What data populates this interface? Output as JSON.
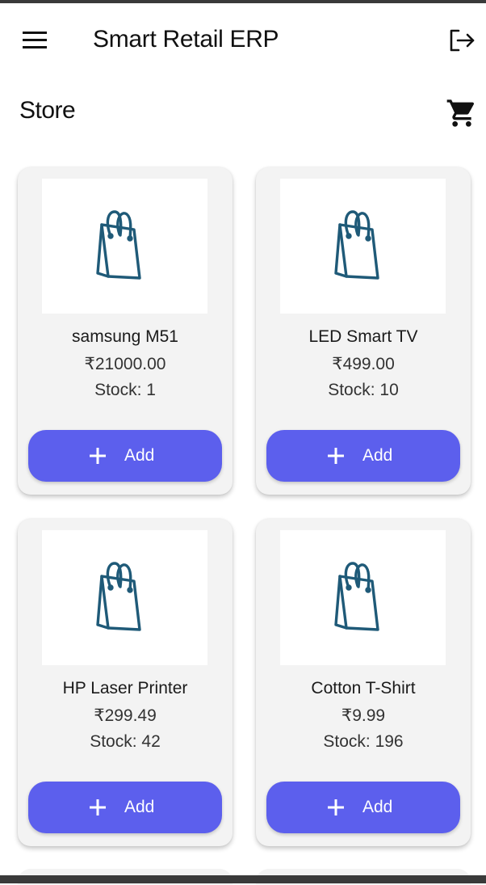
{
  "app_bar": {
    "title": "Smart Retail ERP",
    "menu_icon": "hamburger-menu-icon",
    "logout_icon": "logout-icon"
  },
  "store": {
    "title": "Store",
    "cart_icon": "shopping-cart-icon"
  },
  "theme": {
    "accent": "#5C5FED",
    "icon_color": "#1F5A78",
    "card_bg": "#F3F3F3"
  },
  "products": [
    {
      "name": "samsung M51",
      "price": "₹21000.00",
      "stock": "Stock: 1",
      "add_label": "Add",
      "image_icon": "shopping-bag-icon"
    },
    {
      "name": "LED Smart TV",
      "price": "₹499.00",
      "stock": "Stock: 10",
      "add_label": "Add",
      "image_icon": "shopping-bag-icon"
    },
    {
      "name": "HP Laser Printer",
      "price": "₹299.49",
      "stock": "Stock: 42",
      "add_label": "Add",
      "image_icon": "shopping-bag-icon"
    },
    {
      "name": "Cotton T-Shirt",
      "price": "₹9.99",
      "stock": "Stock: 196",
      "add_label": "Add",
      "image_icon": "shopping-bag-icon"
    }
  ]
}
